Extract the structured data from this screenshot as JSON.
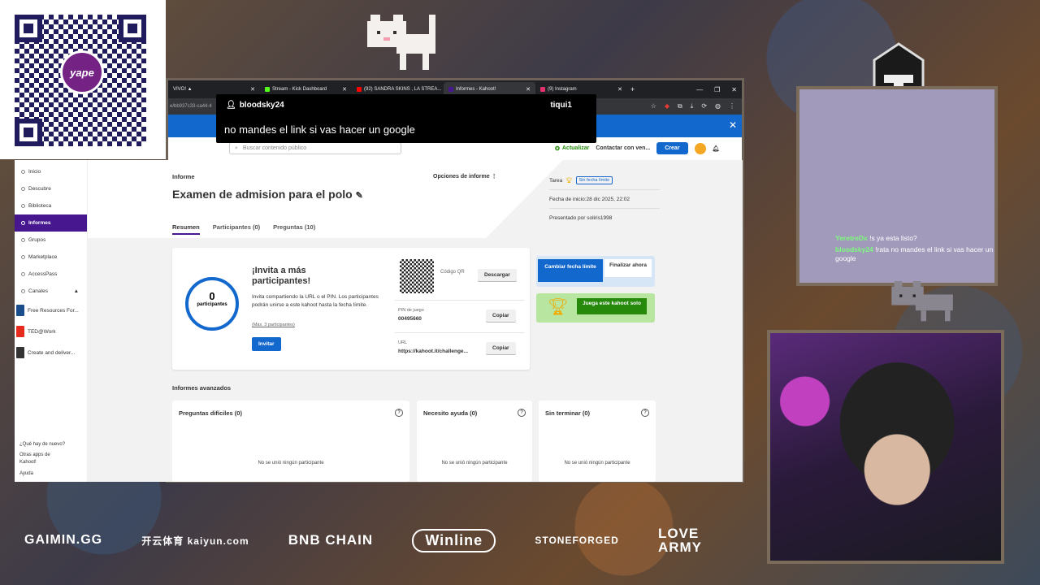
{
  "overlay": {
    "user": "bloodsky24",
    "target": "tiqui1",
    "message": "no mandes el link si vas hacer un google"
  },
  "yape": {
    "logo_text": "yape"
  },
  "browser": {
    "tabs": [
      {
        "label": "VIVO! ▲",
        "color": "#e53935"
      },
      {
        "label": "Stream - Kick Dashboard",
        "color": "#53fc18"
      },
      {
        "label": "(92) SANDRA SKINS , LA STREA...",
        "color": "#ff0000"
      },
      {
        "label": "Informes - Kahoot!",
        "color": "#46178f"
      },
      {
        "label": "(9) Instagram",
        "color": "#e1306c"
      }
    ],
    "url": "e/bb937c33-ca44-4"
  },
  "kahoot": {
    "search_placeholder": "Buscar contenido público",
    "update": "Actualizar",
    "contact": "Contactar con ven...",
    "create": "Crear",
    "sidebar": [
      "Inicio",
      "Descubre",
      "Biblioteca",
      "Informes",
      "Grupos",
      "Marketplace",
      "AccessPass",
      "Canales"
    ],
    "courses": [
      "Free Resources For...",
      "TED@Work",
      "Create and deliver..."
    ],
    "bottom": [
      "¿Qué hay de nuevo?",
      "Otras apps de Kahoot!",
      "Ayuda"
    ],
    "report_label": "Informe",
    "title": "Examen de admision para el polo",
    "options": "Opciones de informe",
    "tabs": [
      "Resumen",
      "Participantes (0)",
      "Preguntas (10)"
    ],
    "task": "Tarea",
    "no_limit": "Sin fecha límite",
    "start": "Fecha de inicio:28 dic 2025, 22:02",
    "presented": "Presentado por soliris1998",
    "count": "0",
    "participants": "participantes",
    "invite_title": "¡Invita a más participantes!",
    "invite_text": "Invita compartiendo la URL o el PIN. Los participantes podrán unirse a este kahoot hasta la fecha límite.",
    "max": "(Máx. 3 participantes)",
    "invite_btn": "Invitar",
    "qr_label": "Código QR",
    "download": "Descargar",
    "pin_label": "PIN de juego",
    "pin": "00495660",
    "copy": "Copiar",
    "url_label": "URL",
    "url": "https://kahoot.it/challenge...",
    "change_date": "Cambiar fecha límite",
    "finish": "Finalizar ahora",
    "play_solo": "Juega este kahoot solo",
    "advanced": "Informes avanzados",
    "cards": [
      {
        "title": "Preguntas difíciles (0)",
        "empty": "No se unió ningún participante"
      },
      {
        "title": "Necesito ayuda (0)",
        "empty": "No se unió ningún participante"
      },
      {
        "title": "Sin terminar (0)",
        "empty": "No se unió ningún participante"
      }
    ]
  },
  "chat": [
    {
      "user": "YeretreDx",
      "text": "!s ya esta listo?"
    },
    {
      "user": "bloodsky24",
      "text": "!rata no mandes el link si vas hacer un google"
    }
  ],
  "sponsors": [
    "GAIMIN.GG",
    "开云体育 kaiyun.com",
    "BNB CHAIN",
    "Winline",
    "STONEFORGED",
    "LOVE ARMY"
  ]
}
